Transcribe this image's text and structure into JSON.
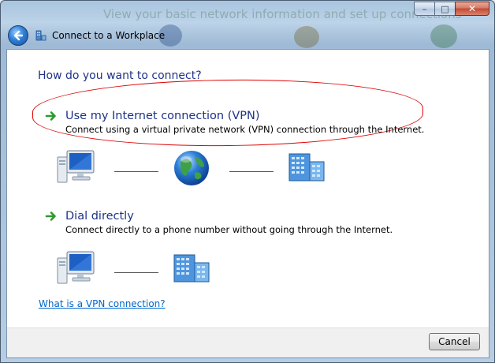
{
  "window": {
    "title": "Connect to a Workplace",
    "background_text": "View your basic network information and set up connections",
    "controls": {
      "minimize": "–",
      "maximize": "□",
      "close": "✕"
    }
  },
  "content": {
    "heading": "How do you want to connect?",
    "options": [
      {
        "title": "Use my Internet connection (VPN)",
        "description": "Connect using a virtual private network (VPN) connection through the Internet."
      },
      {
        "title": "Dial directly",
        "description": "Connect directly to a phone number without going through the Internet."
      }
    ],
    "help_link": "What is a VPN connection?"
  },
  "footer": {
    "cancel_label": "Cancel"
  },
  "icons": {
    "back": "back-arrow-icon",
    "title": "workplace-network-icon",
    "option_arrow": "green-arrow-icon",
    "computer": "computer-icon",
    "globe": "globe-icon",
    "building": "office-building-icon"
  },
  "colors": {
    "heading": "#1e3287",
    "option_arrow": "#2e9a2e",
    "annotation": "#e00000",
    "link": "#0066cc"
  }
}
